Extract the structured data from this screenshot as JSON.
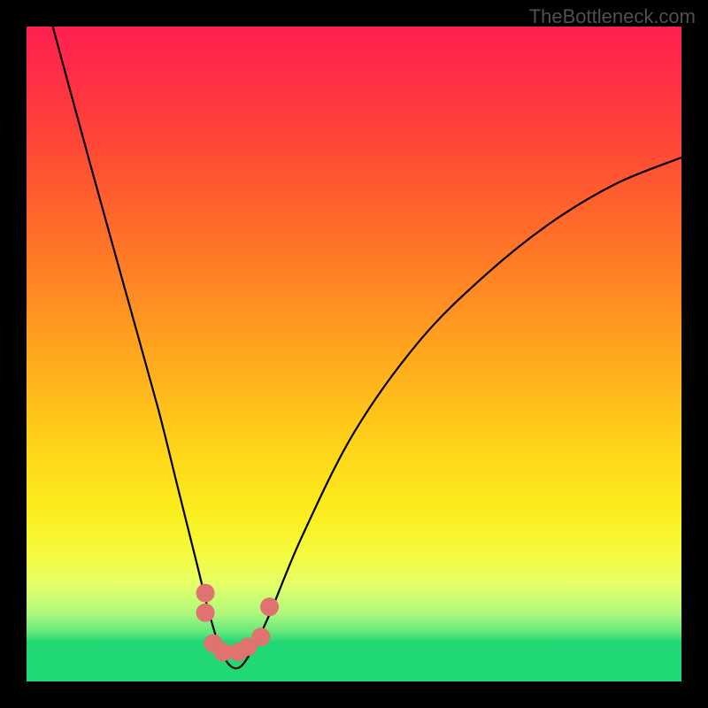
{
  "watermark": {
    "text": "TheBottleneck.com"
  },
  "chart_data": {
    "type": "line",
    "title": "",
    "xlabel": "",
    "ylabel": "",
    "xlim": [
      0,
      100
    ],
    "ylim": [
      0,
      100
    ],
    "series": [
      {
        "name": "bottleneck-curve",
        "x": [
          4,
          10,
          15,
          20,
          23,
          26,
          28,
          30,
          32,
          34,
          37,
          42,
          50,
          60,
          70,
          80,
          90,
          100
        ],
        "values": [
          100,
          78,
          60,
          42,
          30,
          18,
          10,
          4,
          2,
          4,
          10,
          22,
          38,
          52,
          62,
          70,
          76,
          80
        ]
      }
    ],
    "markers": [
      {
        "name": "bottom-dot-cluster",
        "points": [
          {
            "x": 27.3,
            "y": 13.5
          },
          {
            "x": 27.3,
            "y": 10.5
          },
          {
            "x": 28.5,
            "y": 5.8
          },
          {
            "x": 30.0,
            "y": 4.5
          },
          {
            "x": 32.3,
            "y": 4.5
          },
          {
            "x": 33.8,
            "y": 5.3
          },
          {
            "x": 35.8,
            "y": 6.8
          },
          {
            "x": 37.1,
            "y": 11.4
          }
        ],
        "color": "#e0736f"
      }
    ],
    "background_gradient": {
      "direction": "top-to-bottom",
      "stops": [
        {
          "pos": 0.0,
          "color": "#ff1f4f"
        },
        {
          "pos": 0.18,
          "color": "#ff4736"
        },
        {
          "pos": 0.42,
          "color": "#ff8e22"
        },
        {
          "pos": 0.65,
          "color": "#ffd61a"
        },
        {
          "pos": 0.82,
          "color": "#f6fa3a"
        },
        {
          "pos": 0.94,
          "color": "#20d874"
        },
        {
          "pos": 1.0,
          "color": "#20d874"
        }
      ]
    }
  }
}
